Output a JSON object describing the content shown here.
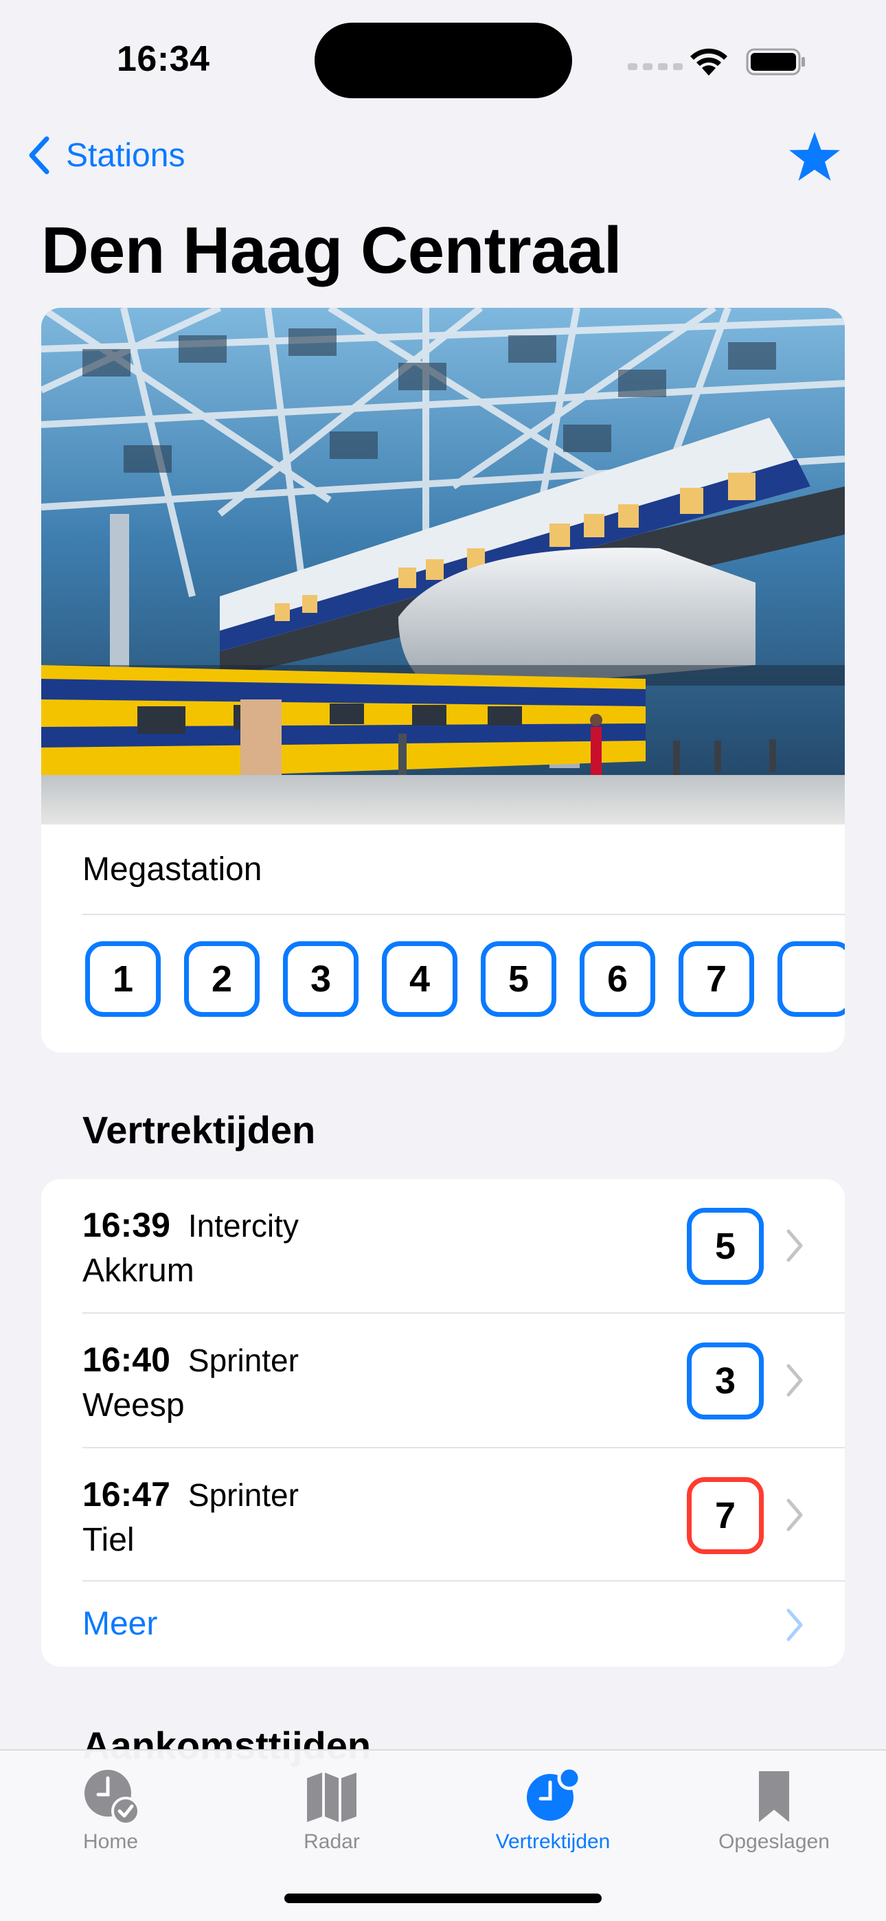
{
  "status_bar": {
    "time": "16:34"
  },
  "nav": {
    "back_label": "Stations"
  },
  "station": {
    "name": "Den Haag Centraal",
    "type": "Megastation",
    "platforms": [
      "1",
      "2",
      "3",
      "4",
      "5",
      "6",
      "7"
    ]
  },
  "departures": {
    "header": "Vertrektijden",
    "items": [
      {
        "time": "16:39",
        "type": "Intercity",
        "destination": "Akkrum",
        "platform": "5",
        "platform_changed": false
      },
      {
        "time": "16:40",
        "type": "Sprinter",
        "destination": "Weesp",
        "platform": "3",
        "platform_changed": false
      },
      {
        "time": "16:47",
        "type": "Sprinter",
        "destination": "Tiel",
        "platform": "7",
        "platform_changed": true
      }
    ],
    "more_label": "Meer"
  },
  "arrivals": {
    "header": "Aankomsttijden"
  },
  "tabs": [
    {
      "label": "Home",
      "icon": "clock-check-icon",
      "active": false
    },
    {
      "label": "Radar",
      "icon": "map-icon",
      "active": false
    },
    {
      "label": "Vertrektijden",
      "icon": "clock-badge-icon",
      "active": true
    },
    {
      "label": "Opgeslagen",
      "icon": "bookmark-icon",
      "active": false
    }
  ],
  "colors": {
    "accent": "#0A7AFF",
    "changed": "#FF3B30",
    "background": "#F2F2F7"
  }
}
